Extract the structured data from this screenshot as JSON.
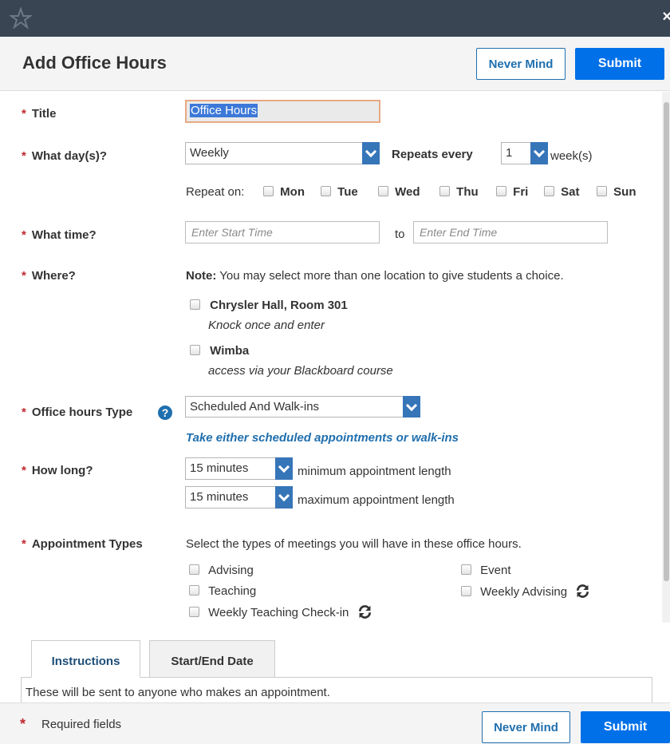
{
  "window": {
    "close_glyph": "×"
  },
  "header": {
    "title": "Add Office Hours",
    "never_mind": "Never Mind",
    "submit": "Submit"
  },
  "form": {
    "title": {
      "label": "Title",
      "value": "Office Hours"
    },
    "days": {
      "label": "What day(s)?",
      "frequency": "Weekly",
      "repeats_label": "Repeats every",
      "repeats_value": "1",
      "repeats_unit": "week(s)",
      "repeat_on_label": "Repeat on:",
      "weekdays": [
        "Mon",
        "Tue",
        "Wed",
        "Thu",
        "Fri",
        "Sat",
        "Sun"
      ]
    },
    "time": {
      "label": "What time?",
      "start_placeholder": "Enter Start Time",
      "to_label": "to",
      "end_placeholder": "Enter End Time"
    },
    "where": {
      "label": "Where?",
      "note_bold": "Note:",
      "note_text": "You may select more than one location to give students a choice.",
      "locations": [
        {
          "name": "Chrysler Hall, Room 301",
          "detail": "Knock once and enter"
        },
        {
          "name": "Wimba",
          "detail": "access via your Blackboard course"
        }
      ]
    },
    "type": {
      "label": "Office hours Type",
      "value": "Scheduled And Walk-ins",
      "description": "Take either scheduled appointments or walk-ins"
    },
    "length": {
      "label": "How long?",
      "min_value": "15 minutes",
      "min_text": "minimum appointment length",
      "max_value": "15 minutes",
      "max_text": "maximum appointment length"
    },
    "appointment_types": {
      "label": "Appointment Types",
      "intro": "Select the types of meetings you will have in these office hours.",
      "items": [
        "Advising",
        "Teaching",
        "Weekly Teaching Check-in",
        "Event",
        "Weekly Advising"
      ]
    }
  },
  "tabs": [
    {
      "label": "Instructions"
    },
    {
      "label": "Start/End Date"
    }
  ],
  "instructions_text": "These will be sent to anyone who makes an appointment.",
  "footer": {
    "required_text": "Required fields",
    "never_mind": "Never Mind",
    "submit": "Submit"
  },
  "colors": {
    "topbar": "#394553",
    "primary": "#0070e8",
    "required": "#c0282d",
    "link": "#1f6fae"
  }
}
